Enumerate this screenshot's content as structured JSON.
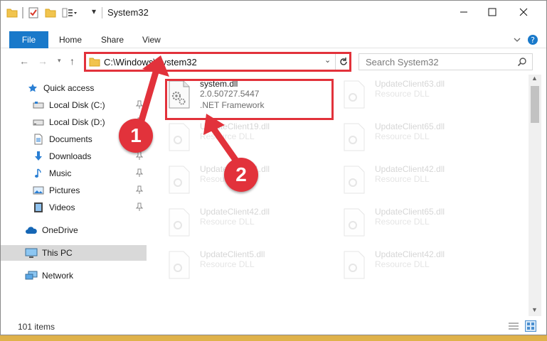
{
  "window": {
    "title": "System32"
  },
  "ribbon": {
    "file": "File",
    "home": "Home",
    "share": "Share",
    "view": "View"
  },
  "address": {
    "path": "C:\\Windows\\System32",
    "search_placeholder": "Search System32"
  },
  "sidebar": {
    "items": [
      {
        "label": "Quick access"
      },
      {
        "label": "Local Disk (C:)"
      },
      {
        "label": "Local Disk (D:)"
      },
      {
        "label": "Documents"
      },
      {
        "label": "Downloads"
      },
      {
        "label": "Music"
      },
      {
        "label": "Pictures"
      },
      {
        "label": "Videos"
      },
      {
        "label": "OneDrive"
      },
      {
        "label": "This PC"
      },
      {
        "label": "Network"
      }
    ]
  },
  "files": [
    {
      "name": "system.dll",
      "sub": "2.0.50727.5447",
      "sub2": ".NET Framework"
    },
    {
      "name": "UpdateClient63.dll",
      "sub": "Resource DLL"
    },
    {
      "name": "UpdateClient19.dll",
      "sub": "Resource DLL"
    },
    {
      "name": "UpdateClient65.dll",
      "sub": "Resource DLL"
    },
    {
      "name": "UpdateClient21.dll",
      "sub": "Resource DLL"
    },
    {
      "name": "UpdateClient42.dll",
      "sub": "Resource DLL"
    },
    {
      "name": "UpdateClient42.dll",
      "sub": "Resource DLL"
    },
    {
      "name": "UpdateClient65.dll",
      "sub": "Resource DLL"
    },
    {
      "name": "UpdateClient5.dll",
      "sub": "Resource DLL"
    },
    {
      "name": "UpdateClient42.dll",
      "sub": "Resource DLL"
    }
  ],
  "status": {
    "count": "101 items"
  },
  "annotations": {
    "one": "1",
    "two": "2"
  },
  "colors": {
    "accent": "#1979ca",
    "highlight": "#e2323b",
    "selected": "#d9d9d9"
  },
  "icons": {
    "folder": "folder-icon",
    "quick_access": "star-icon",
    "drive": "drive-icon",
    "documents": "documents-icon",
    "downloads": "download-icon",
    "music": "music-icon",
    "pictures": "pictures-icon",
    "videos": "videos-icon",
    "onedrive": "cloud-icon",
    "this_pc": "computer-icon",
    "network": "network-icon",
    "dll": "dll-file-icon"
  }
}
